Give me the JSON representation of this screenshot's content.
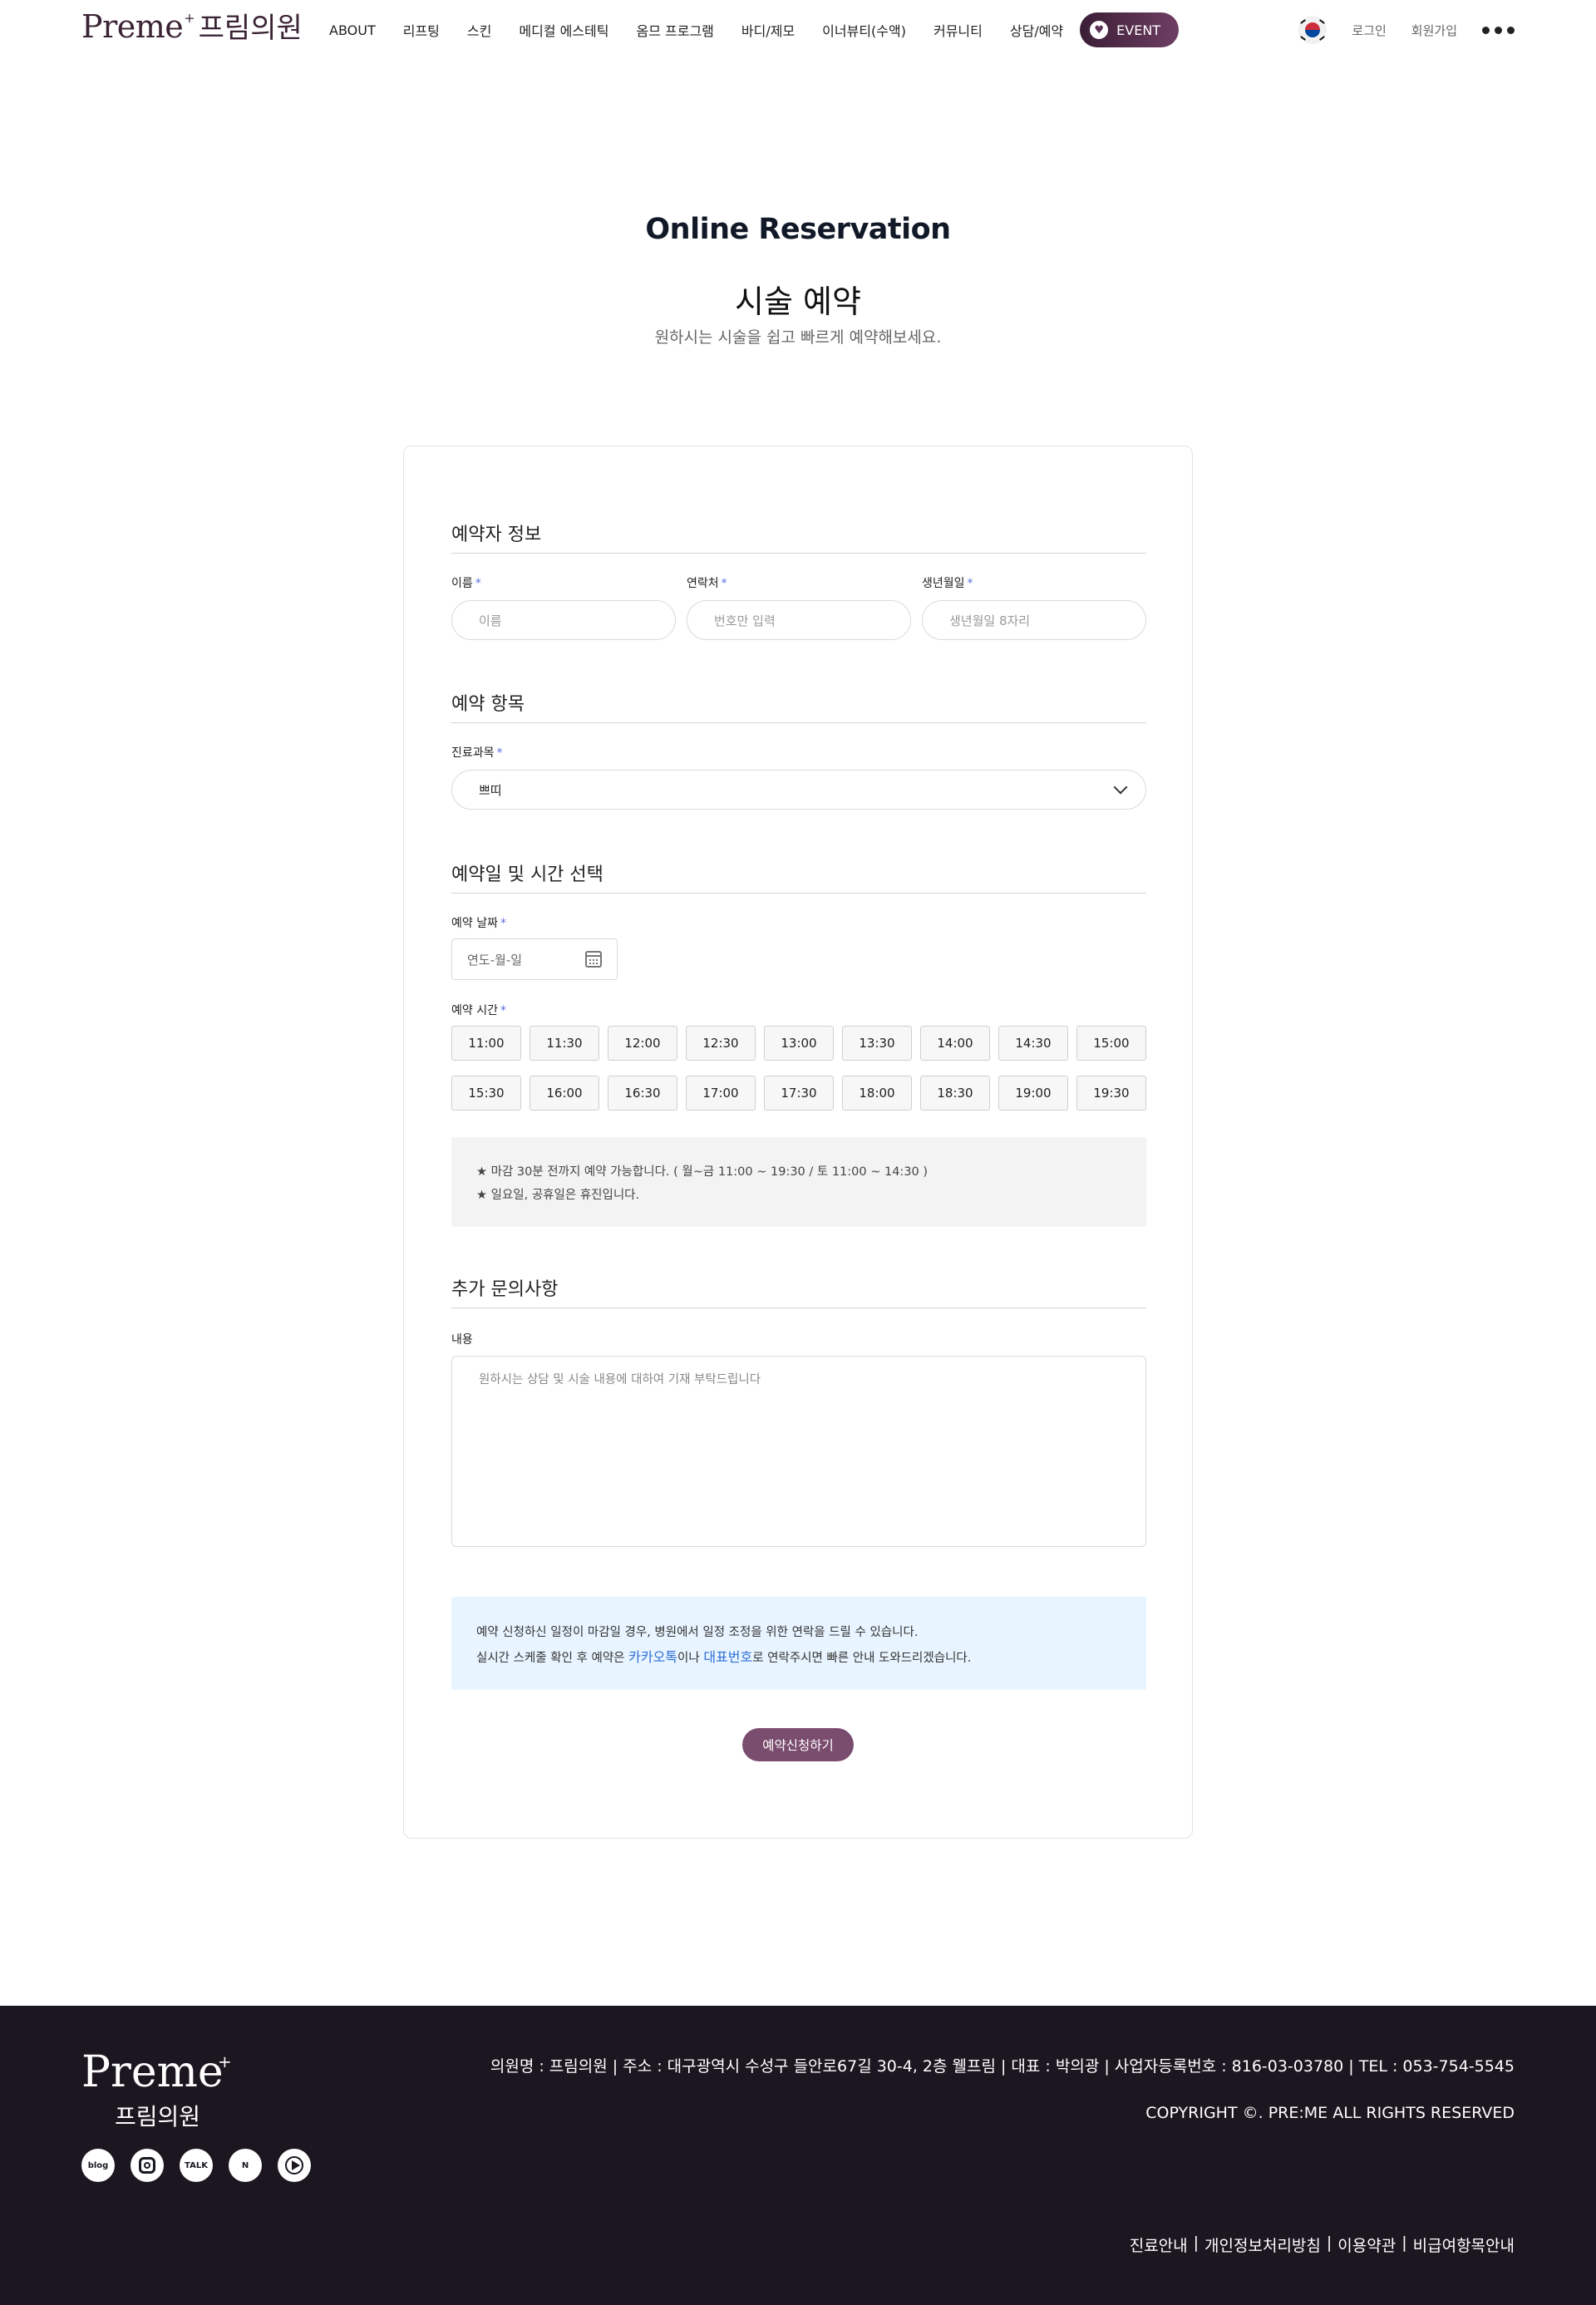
{
  "header": {
    "logo_en": "Preme",
    "logo_plus": "+",
    "logo_ko": "프림의원",
    "nav": [
      "ABOUT",
      "리프팅",
      "스킨",
      "메디컬 에스테틱",
      "옴므 프로그램",
      "바디/제모",
      "이너뷰티(수액)",
      "커뮤니티",
      "상담/예약"
    ],
    "event_label": "EVENT",
    "login": "로그인",
    "signup": "회원가입"
  },
  "title": {
    "en": "Online Reservation",
    "ko": "시술 예약",
    "subtitle": "원하시는 시술을 쉽고 빠르게 예약해보세요."
  },
  "form": {
    "section_info": "예약자 정보",
    "name_label": "이름",
    "name_placeholder": "이름",
    "phone_label": "연락처",
    "phone_placeholder": "번호만 입력",
    "birth_label": "생년월일",
    "birth_placeholder": "생년월일 8자리",
    "required_mark": "*",
    "section_item": "예약 항목",
    "dept_label": "진료과목",
    "dept_value": "쁘띠",
    "section_datetime": "예약일 및 시간 선택",
    "date_label": "예약 날짜",
    "date_placeholder": "연도-월-일",
    "time_label": "예약 시간",
    "times": [
      "11:00",
      "11:30",
      "12:00",
      "12:30",
      "13:00",
      "13:30",
      "14:00",
      "14:30",
      "15:00",
      "15:30",
      "16:00",
      "16:30",
      "17:00",
      "17:30",
      "18:00",
      "18:30",
      "19:00",
      "19:30"
    ],
    "notice_1": "★ 마감 30분 전까지 예약 가능합니다. ( 월~금 11:00 ~ 19:30 / 토 11:00 ~ 14:30 )",
    "notice_2": "★ 일요일, 공휴일은 휴진입니다.",
    "section_extra": "추가 문의사항",
    "content_label": "내용",
    "content_placeholder": "원하시는 상담 및 시술 내용에 대하여 기재 부탁드립니다",
    "info_line_1": "예약 신청하신 일정이 마감일 경우, 병원에서 일정 조정을 위한 연락을 드릴 수 있습니다.",
    "info_line_2_a": "실시간 스케줄 확인 후 예약은 ",
    "info_kakao": "카카오톡",
    "info_line_2_b": "이나 ",
    "info_phone": "대표번호",
    "info_line_2_c": "로 연락주시면 빠른 안내 도와드리겠습니다.",
    "submit": "예약신청하기"
  },
  "footer": {
    "logo_en": "Preme",
    "logo_plus": "+",
    "logo_ko": "프림의원",
    "info": "의원명 : 프림의원 | 주소 : 대구광역시 수성구 들안로67길 30-4, 2층 웰프림 | 대표 : 박의광 | 사업자등록번호 : 816-03-03780 | TEL : 053-754-5545",
    "copyright": "COPYRIGHT ©. PRE:ME ALL RIGHTS RESERVED",
    "links": [
      "진료안내",
      "개인정보처리방침",
      "이용약관",
      "비급여항목안내"
    ],
    "link_sep": "|",
    "social_blog": "blog",
    "social_talk": "TALK",
    "social_n": "N"
  }
}
